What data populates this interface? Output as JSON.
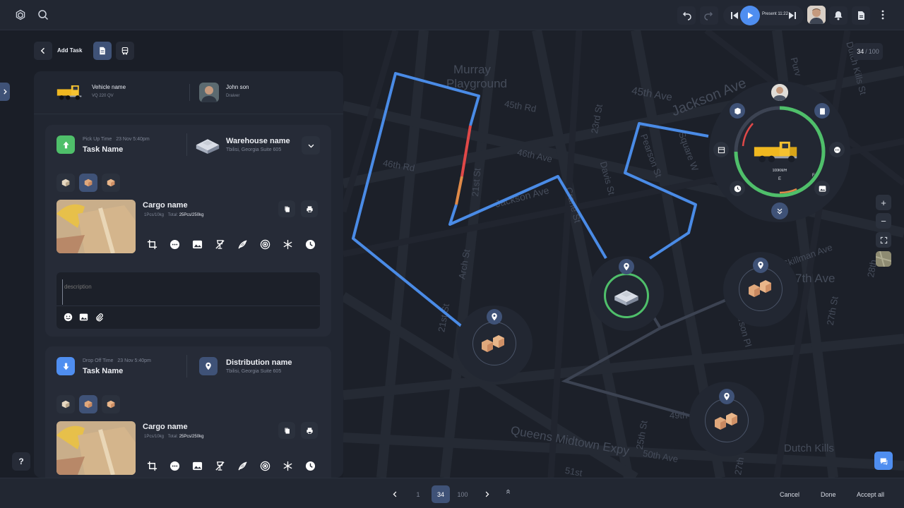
{
  "topbar": {
    "present_label": "Present 11:22",
    "counter_current": "34",
    "counter_sep": "/",
    "counter_total": "100"
  },
  "toolbar": {
    "back_label": "Add Task"
  },
  "vehicle": {
    "name_label": "Vehicle name",
    "plate": "VQ 220 QV",
    "driver_name": "John son",
    "driver_role": "Draiver"
  },
  "pickup": {
    "time_label": "Pick Up Time",
    "time_value": "23 Nov 5:40pm",
    "task_name": "Task Name",
    "place_name": "Warehouse name",
    "place_address": "Tbilisi, Georgia Suite 605",
    "cargo_name": "Cargo name",
    "cargo_pcs": "1Pcs/10kg",
    "cargo_total_label": "Total:",
    "cargo_total_value": "25Pcs/250kg",
    "description_placeholder": "description"
  },
  "dropoff": {
    "time_label": "Drop Off Time",
    "time_value": "23 Nov 5:40pm",
    "task_name": "Task Name",
    "place_name": "Distribution name",
    "place_address": "Tbilisi, Georgia Suite 605",
    "cargo_name": "Cargo name",
    "cargo_pcs": "1Pcs/10kg",
    "cargo_total_label": "Total:",
    "cargo_total_value": "25Pcs/250kg"
  },
  "map": {
    "streets": [
      "Murray",
      "Playground",
      "45th Ave",
      "Jackson Ave",
      "45th Rd",
      "23rd St",
      "46th Ave",
      "Davis St",
      "Pearson St",
      "Square W",
      "46th Rd",
      "21st St",
      "Jackson Ave",
      "Crane St",
      "Skillman Ave",
      "7th Ave",
      "27th St",
      "Pearson Pl",
      "Arch St",
      "21st St",
      "49th",
      "25th St",
      "Queens Midtown Expy",
      "50th Ave",
      "Dutch Kills",
      "51st",
      "27th",
      "Purv",
      "Dutch Kills St",
      "28th"
    ],
    "gauge_text": "100KM/H",
    "fuel_full": "F",
    "fuel_empty": "E",
    "zoom_in": "+",
    "zoom_out": "−"
  },
  "pagination": {
    "first": "1",
    "current": "34",
    "last": "100"
  },
  "actions": {
    "cancel": "Cancel",
    "done": "Done",
    "accept_all": "Accept all"
  },
  "help": "?",
  "colors": {
    "accent_blue": "#4f8ef0",
    "route_blue": "#4a8be6",
    "green": "#4fbf6a",
    "red": "#e04848",
    "panel": "#212631",
    "card": "#262b37"
  }
}
